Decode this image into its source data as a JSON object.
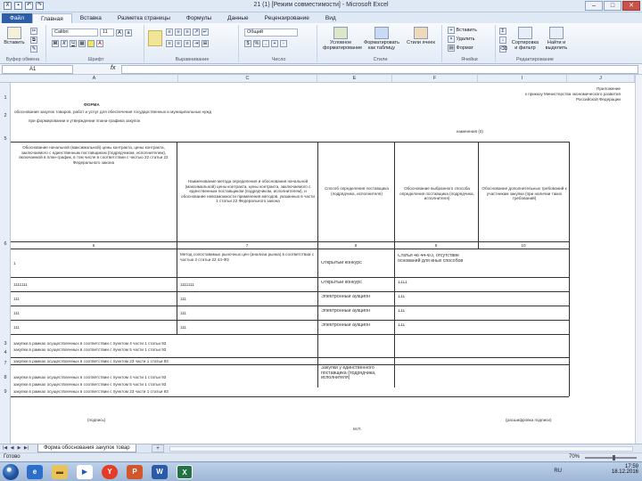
{
  "window": {
    "title": "21 (1) [Режим совместимости] - Microsoft Excel",
    "controls": [
      "–",
      "□",
      "✕"
    ]
  },
  "tabs": [
    {
      "label": "Файл"
    },
    {
      "label": "Главная"
    },
    {
      "label": "Вставка"
    },
    {
      "label": "Разметка страницы"
    },
    {
      "label": "Формулы"
    },
    {
      "label": "Данные"
    },
    {
      "label": "Рецензирование"
    },
    {
      "label": "Вид"
    }
  ],
  "ribbon": {
    "clipboard": {
      "paste": "Вставить",
      "label": "Буфер обмена"
    },
    "font": {
      "name": "Calibri",
      "size": "11",
      "label": "Шрифт"
    },
    "alignment": {
      "label": "Выравнивание"
    },
    "number": {
      "format": "Общий",
      "label": "Число"
    },
    "styles": {
      "conditional": "Условное форматирование",
      "table": "Форматировать как таблицу",
      "cell": "Стили ячеек",
      "label": "Стили"
    },
    "cells": {
      "insert": "Вставить",
      "delete": "Удалить",
      "format": "Формат",
      "label": "Ячейки"
    },
    "editing": {
      "sort": "Сортировка и фильтр",
      "find": "Найти и выделить",
      "label": "Редактирование"
    }
  },
  "formula_bar": {
    "name_box": "A1",
    "fx": "fx",
    "value": ""
  },
  "columns": [
    "A",
    "C",
    "E",
    "F",
    "I",
    "J"
  ],
  "rows": [
    "1",
    "2",
    "3",
    "4",
    "5",
    "6",
    "7",
    "8",
    "9"
  ],
  "sheet": {
    "header_right": [
      "Приложение",
      "к приказу Министерства экономического развития",
      "Российской Федерации"
    ],
    "form_title": "ФОРМА",
    "form_subtitle": "обоснования закупок товаров, работ и услуг для обеспечения государственных и муниципальных нужд",
    "form_subtitle2": "при формировании и утверждении плана-графика закупок",
    "version": "изменения (0)",
    "col_headers": [
      "Обоснование начальной (максимальной) цены контракта, цены контракта, заключаемого с единственным поставщиком (подрядчиком, исполнителем), включаемой в план-график, в том числе в соответствии с частью 22 статьи 22 Федерального закона",
      "Наименование метода определения и обоснования начальной (максимальной) цены контракта, цены контракта, заключаемого с единственным поставщиком (подрядчиком, исполнителем), и обоснование невозможности применения методов, указанных в части 1 статьи 22 Федерального закона",
      "Способ определения поставщика (подрядчика, исполнителя)",
      "Обоснование выбранного способа определения поставщика (подрядчика, исполнителя)",
      "Обоснование дополнительных требований к участникам закупки (при наличии таких требований)"
    ],
    "col_numbers": [
      "6",
      "7",
      "8",
      "9",
      "10"
    ],
    "rows": [
      {
        "a": "1",
        "b": "Метод сопоставимых рыночных цен (анализа рынка) в соответствии с частью 2 статьи 22 44-ФЗ",
        "c": "Открытый конкурс",
        "d": "Статья 48 44-ФЗ, отсутствие оснований для иных способов"
      },
      {
        "a": "1111111",
        "b": "1111111",
        "c": "Открытый конкурс",
        "d": "1111"
      },
      {
        "a": "111",
        "b": "111",
        "c": "Электронный аукцион",
        "d": "111"
      },
      {
        "a": "111",
        "b": "111",
        "c": "Электронный аукцион",
        "d": "111"
      },
      {
        "a": "111",
        "b": "111",
        "c": "Электронный аукцион",
        "d": "111"
      }
    ],
    "bottom_lines": [
      "закупки в рамках осуществленных в соответствии с пунктом 4 части 1 статьи 93",
      "закупки в рамках осуществленных в соответствии с пунктом 5 части 1 статьи 93",
      "закупки в рамках осуществленных в соответствии с пунктом 23 части 1 статьи 93"
    ],
    "bottom_note": "Закупки у единственного поставщика (подрядчика, исполнителя)",
    "bottom_lines2": [
      "закупки в рамках осуществленных в соответствии с пунктом 4 части 1 статьи 93",
      "закупки в рамках осуществленных в соответствии с пунктом 5 части 1 статьи 93",
      "закупки в рамках осуществленных в соответствии с пунктом 23 части 1 статьи 93"
    ],
    "sign_left": "(подпись)",
    "sign_right": "(расшифровка подписи)",
    "sign_mid": "М.П."
  },
  "sheet_tabs": {
    "active": "Форма обоснования закупок товар",
    "add": "+"
  },
  "status": {
    "ready": "Готово",
    "zoom": "70%"
  },
  "taskbar": {
    "apps": [
      "start",
      "ie",
      "folder",
      "media",
      "yandex",
      "powerpoint",
      "word",
      "excel"
    ],
    "lang": "RU",
    "time": "17:59",
    "date": "18.12.2016"
  }
}
